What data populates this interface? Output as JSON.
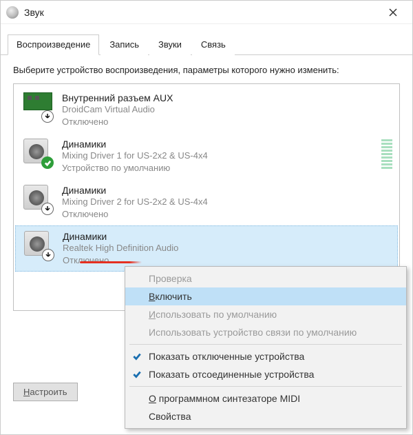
{
  "window": {
    "title": "Звук"
  },
  "tabs": [
    {
      "label": "Воспроизведение",
      "active": true
    },
    {
      "label": "Запись",
      "active": false
    },
    {
      "label": "Звуки",
      "active": false
    },
    {
      "label": "Связь",
      "active": false
    }
  ],
  "instruction": "Выберите устройство воспроизведения, параметры которого нужно изменить:",
  "devices": [
    {
      "name": "Внутренний разъем  AUX",
      "sub1": "DroidCam Virtual Audio",
      "sub2": "Отключено",
      "icon": "pcb",
      "overlay": "arrow"
    },
    {
      "name": "Динамики",
      "sub1": "Mixing Driver 1 for US-2x2 & US-4x4",
      "sub2": "Устройство по умолчанию",
      "icon": "speaker",
      "overlay": "check",
      "meter": true
    },
    {
      "name": "Динамики",
      "sub1": "Mixing Driver 2 for US-2x2 & US-4x4",
      "sub2": "Отключено",
      "icon": "speaker",
      "overlay": "arrow"
    },
    {
      "name": "Динамики",
      "sub1": "Realtek High Definition Audio",
      "sub2": "Отключено",
      "icon": "speaker",
      "overlay": "arrow",
      "selected": true
    }
  ],
  "context_menu": {
    "items": [
      {
        "label": "Проверка",
        "type": "item",
        "disabled": true
      },
      {
        "label": "Включить",
        "type": "item",
        "hover": true,
        "accel_pos": 0
      },
      {
        "label": "Использовать по умолчанию",
        "type": "item",
        "disabled": true,
        "accel_pos": 0
      },
      {
        "label": "Использовать устройство связи по умолчанию",
        "type": "item",
        "disabled": true
      },
      {
        "type": "sep"
      },
      {
        "label": "Показать отключенные устройства",
        "type": "item",
        "checked": true
      },
      {
        "label": "Показать отсоединенные устройства",
        "type": "item",
        "checked": true
      },
      {
        "type": "sep"
      },
      {
        "label": "О программном синтезаторе MIDI",
        "type": "item",
        "accel_pos": 0
      },
      {
        "label": "Свойства",
        "type": "item"
      }
    ]
  },
  "footer": {
    "configure": "Настроить",
    "configure_accel_pos": 0
  }
}
